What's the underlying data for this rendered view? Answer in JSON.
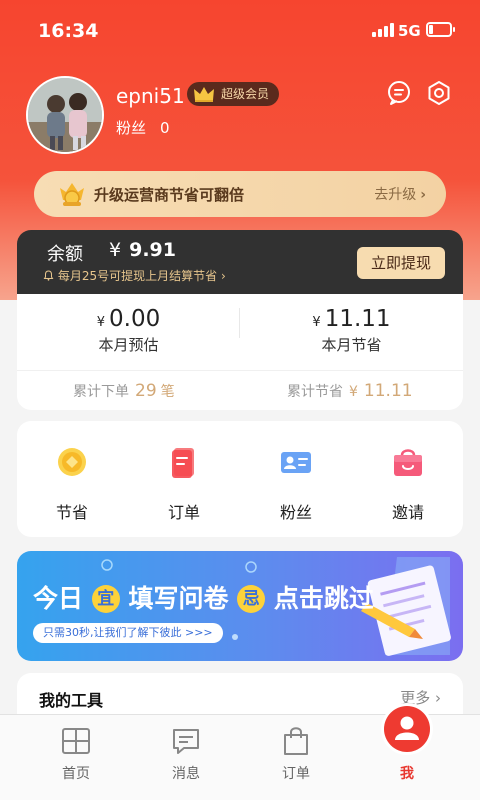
{
  "status_bar": {
    "time": "16:34",
    "network": "5G",
    "battery_level": 0.2
  },
  "profile": {
    "username": "epni51",
    "vip_label": "超级会员",
    "fans_label": "粉丝",
    "fans_count": "0"
  },
  "upgrade": {
    "text": "升级运营商节省可翻倍",
    "action": "去升级"
  },
  "balance": {
    "label": "余额",
    "currency": "¥",
    "amount": "9.91",
    "note": "每月25号可提现上月结算节省",
    "withdraw_label": "立即提现"
  },
  "stats": {
    "estimate": {
      "currency": "¥",
      "value": "0.00",
      "label": "本月预估"
    },
    "saved": {
      "currency": "¥",
      "value": "11.11",
      "label": "本月节省"
    },
    "cum_orders_label": "累计下单",
    "cum_orders_value": "29",
    "cum_orders_unit": "笔",
    "cum_saved_label": "累计节省",
    "cum_saved_currency": "¥",
    "cum_saved_value": "11.11"
  },
  "menu": {
    "items": [
      {
        "label": "节省",
        "icon": "coin-icon"
      },
      {
        "label": "订单",
        "icon": "order-icon"
      },
      {
        "label": "粉丝",
        "icon": "id-card-icon"
      },
      {
        "label": "邀请",
        "icon": "gift-bag-icon"
      }
    ]
  },
  "banner": {
    "part1": "今日",
    "badge1": "宜",
    "part2": "填写问卷",
    "badge2": "忌",
    "part3": "点击跳过",
    "subtitle": "只需30秒,让我们了解下彼此 >>>"
  },
  "tools": {
    "title": "我的工具",
    "more": "更多"
  },
  "tabbar": {
    "tabs": [
      {
        "label": "首页",
        "icon": "grid-icon"
      },
      {
        "label": "消息",
        "icon": "message-icon"
      },
      {
        "label": "订单",
        "icon": "bag-icon"
      },
      {
        "label": "我",
        "icon": "user-icon"
      }
    ],
    "active_index": 3
  },
  "colors": {
    "primary_red": "#f6452f",
    "gold_accent": "#d2a877",
    "dark_card": "#313131",
    "active_tab": "#e8372f"
  }
}
